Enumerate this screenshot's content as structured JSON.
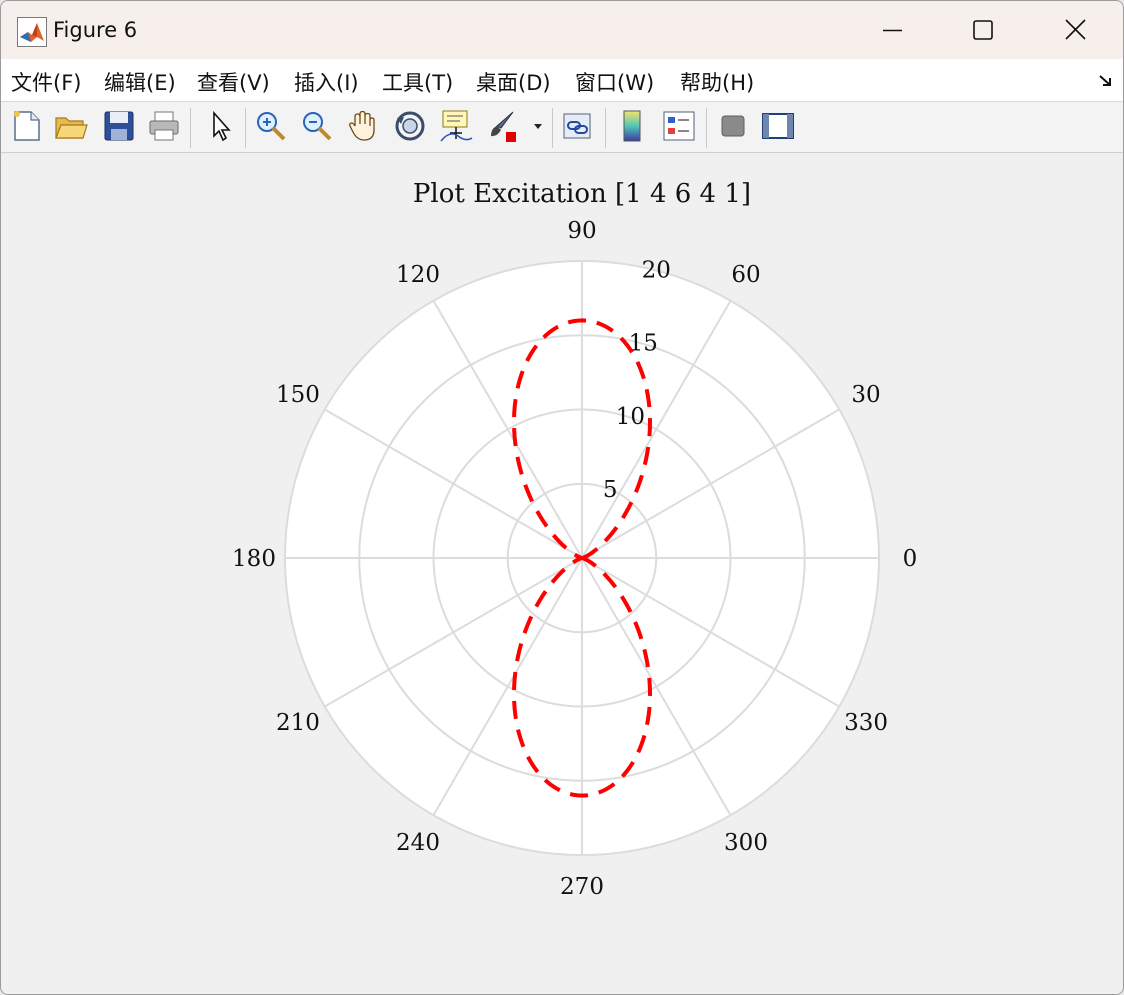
{
  "window": {
    "title": "Figure 6",
    "controls": [
      "minimize",
      "maximize",
      "close"
    ]
  },
  "menu": {
    "items": [
      {
        "label": "文件(F)",
        "id": "file"
      },
      {
        "label": "编辑(E)",
        "id": "edit"
      },
      {
        "label": "查看(V)",
        "id": "view"
      },
      {
        "label": "插入(I)",
        "id": "insert"
      },
      {
        "label": "工具(T)",
        "id": "tools"
      },
      {
        "label": "桌面(D)",
        "id": "desktop"
      },
      {
        "label": "窗口(W)",
        "id": "window"
      },
      {
        "label": "帮助(H)",
        "id": "help"
      }
    ]
  },
  "toolbar": {
    "icons": [
      "new-figure-icon",
      "open-file-icon",
      "save-icon",
      "print-icon",
      "select-pointer-icon",
      "zoom-in-icon",
      "zoom-out-icon",
      "pan-hand-icon",
      "rotate-3d-icon",
      "data-cursor-icon",
      "brush-icon",
      "brush-dropdown-icon",
      "link-plot-icon",
      "colorbar-icon",
      "legend-icon",
      "hide-plot-tools-icon",
      "show-plot-tools-icon"
    ]
  },
  "chart_data": {
    "type": "polar-line",
    "title": "Plot Excitation [1 4 6 4 1]",
    "theta_tick_labels": [
      "0",
      "30",
      "60",
      "90",
      "120",
      "150",
      "180",
      "210",
      "240",
      "270",
      "300",
      "330"
    ],
    "r_tick_labels": [
      "5",
      "10",
      "15",
      "20"
    ],
    "r_lim": [
      0,
      20
    ],
    "grid": true,
    "series": [
      {
        "line_style": "dashed",
        "color": "#ff0000",
        "peak_value": 16,
        "theta_deg": [
          0,
          15,
          30,
          45,
          60,
          70,
          75,
          80,
          85,
          90,
          95,
          100,
          105,
          110,
          120,
          135,
          150,
          165,
          180,
          195,
          210,
          225,
          240,
          250,
          255,
          260,
          265,
          270,
          275,
          280,
          285,
          290,
          300,
          315,
          330,
          345,
          360
        ],
        "r": [
          0,
          0,
          0.5,
          2.2,
          6.2,
          10.1,
          11.9,
          13.9,
          15.4,
          16.0,
          15.4,
          13.9,
          11.9,
          10.1,
          6.2,
          2.2,
          0.5,
          0,
          0,
          0,
          0.5,
          2.2,
          6.2,
          10.1,
          11.9,
          13.9,
          15.4,
          16.0,
          15.4,
          13.9,
          11.9,
          10.1,
          6.2,
          2.2,
          0.5,
          0,
          0
        ]
      }
    ]
  },
  "colors": {
    "title_bar": "#f7efec",
    "figure_bg": "#f0f0f0",
    "axes_bg": "#ffffff",
    "grid": "#dcdcdc",
    "series": "#ff0000"
  }
}
